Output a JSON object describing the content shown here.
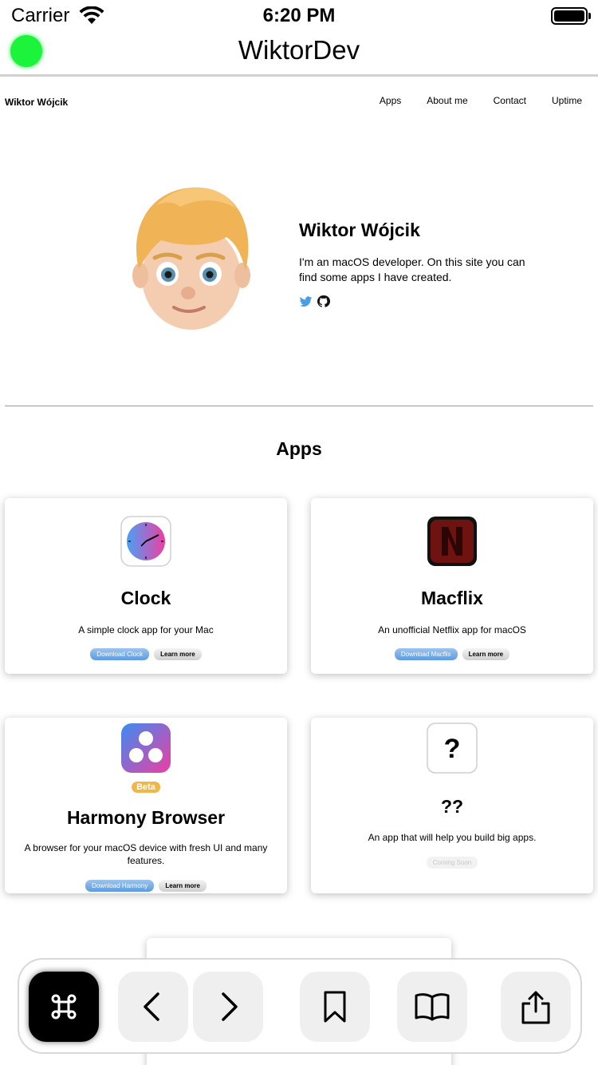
{
  "status_bar": {
    "carrier": "Carrier",
    "time": "6:20 PM"
  },
  "app": {
    "title": "WiktorDev",
    "indicator_color": "#1cf43c"
  },
  "site": {
    "brand": "Wiktor Wójcik",
    "nav": [
      "Apps",
      "About me",
      "Contact",
      "Uptime"
    ],
    "hero": {
      "name": "Wiktor Wójcik",
      "description": "I'm an macOS developer. On this site you can find some apps I have created.",
      "social_icons": [
        "twitter-icon",
        "github-icon"
      ]
    },
    "apps_section": {
      "title": "Apps",
      "cards": [
        {
          "icon": "clock-app-icon",
          "title": "Clock",
          "description": "A simple clock app for your Mac",
          "download_label": "Download Clock",
          "learn_label": "Learn more"
        },
        {
          "icon": "macflix-app-icon",
          "title": "Macflix",
          "description": "An unofficial Netflix app for macOS",
          "download_label": "Download Macflix",
          "learn_label": "Learn more"
        },
        {
          "icon": "harmony-app-icon",
          "badge": "Beta",
          "title": "Harmony Browser",
          "description": "A browser for your macOS device with fresh UI and many features.",
          "download_label": "Download Harmony",
          "learn_label": "Learn more"
        },
        {
          "icon": "question-mark-icon",
          "title": "??",
          "description": "An app that will help you build big apps.",
          "status_label": "Coming Soon"
        }
      ]
    }
  },
  "toolbar": {
    "buttons": [
      "command-icon",
      "back-icon",
      "forward-icon",
      "bookmark-icon",
      "reading-list-icon",
      "share-icon"
    ],
    "accent": "#000000"
  }
}
